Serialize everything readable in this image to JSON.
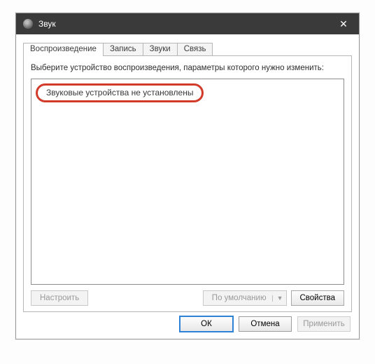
{
  "titlebar": {
    "title": "Звук"
  },
  "tabs": [
    {
      "label": "Воспроизведение"
    },
    {
      "label": "Запись"
    },
    {
      "label": "Звуки"
    },
    {
      "label": "Связь"
    }
  ],
  "panel": {
    "instruction": "Выберите устройство воспроизведения, параметры которого нужно изменить:",
    "empty_message": "Звуковые устройства не установлены",
    "configure_label": "Настроить",
    "default_label": "По умолчанию",
    "properties_label": "Свойства"
  },
  "dialog": {
    "ok": "ОК",
    "cancel": "Отмена",
    "apply": "Применить"
  }
}
